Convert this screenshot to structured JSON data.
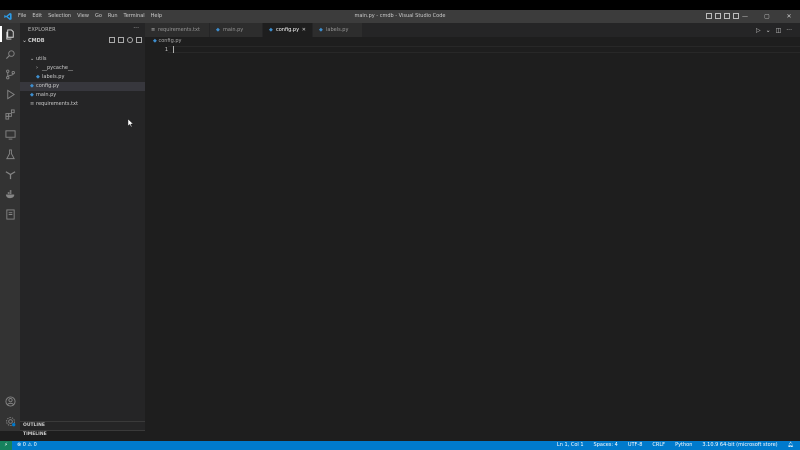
{
  "titlebar": {
    "menu": [
      "File",
      "Edit",
      "Selection",
      "View",
      "Go",
      "Run",
      "Terminal",
      "Help"
    ],
    "title": "main.py - cmdb - Visual Studio Code",
    "controls": {
      "minimize": "—",
      "maximize": "▢",
      "close": "✕"
    }
  },
  "activity_icons": [
    "files-icon",
    "search-icon",
    "source-control-icon",
    "run-debug-icon",
    "extensions-icon",
    "remote-explorer-icon",
    "testing-icon",
    "git-graph-icon",
    "docker-icon",
    "notebook-icon",
    "account-icon",
    "settings-gear-icon"
  ],
  "sidebar": {
    "title": "EXPLORER",
    "more": "···",
    "root": "CMDB",
    "tree": [
      {
        "name": "utils",
        "type": "folder",
        "depth": 1,
        "open": true
      },
      {
        "name": "__pycache__",
        "type": "folder",
        "depth": 2,
        "open": false
      },
      {
        "name": "labels.py",
        "type": "py",
        "depth": 2
      },
      {
        "name": "config.py",
        "type": "py",
        "depth": 1,
        "selected": true
      },
      {
        "name": "main.py",
        "type": "py",
        "depth": 1
      },
      {
        "name": "requirements.txt",
        "type": "txt",
        "depth": 1
      }
    ],
    "outline": "OUTLINE",
    "timeline": "TIMELINE"
  },
  "tabs": [
    {
      "name": "requirements.txt",
      "type": "txt"
    },
    {
      "name": "main.py",
      "type": "py"
    },
    {
      "name": "config.py",
      "type": "py",
      "active": true,
      "close": "✕"
    },
    {
      "name": "labels.py",
      "type": "py"
    }
  ],
  "editor": {
    "breadcrumb": "config.py",
    "line_number": "1"
  },
  "statusbar": {
    "remote": "⚡",
    "problems": "⊗ 0 ⚠ 0",
    "right": [
      "Ln 1, Col 1",
      "Spaces: 4",
      "UTF-8",
      "CRLF",
      "Python",
      "3.10.9 64-bit (microsoft store)"
    ]
  },
  "colors": {
    "accent": "#007acc",
    "python_icon": "#3e8fd0"
  }
}
